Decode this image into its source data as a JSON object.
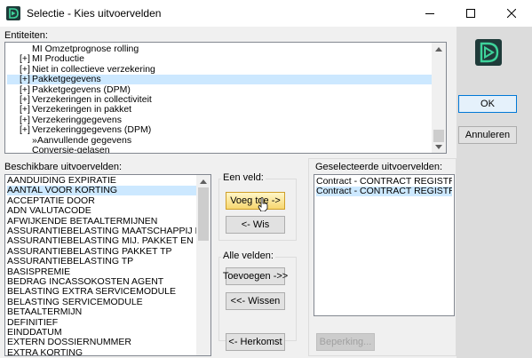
{
  "window": {
    "title": "Selectie - Kies uitvoervelden"
  },
  "entities": {
    "label": "Entiteiten:",
    "items": [
      {
        "prefix": "",
        "text": "MI Omzetprognose rolling",
        "selected": false
      },
      {
        "prefix": "[+]",
        "text": "MI Productie",
        "selected": false
      },
      {
        "prefix": "[+]",
        "text": "Niet in collectieve verzekering",
        "selected": false
      },
      {
        "prefix": "[+]",
        "text": "Pakketgegevens",
        "selected": true
      },
      {
        "prefix": "[+]",
        "text": "Pakketgegevens (DPM)",
        "selected": false
      },
      {
        "prefix": "[+]",
        "text": "Verzekeringen in collectiviteit",
        "selected": false
      },
      {
        "prefix": "[+]",
        "text": "Verzekeringen in pakket",
        "selected": false
      },
      {
        "prefix": "[+]",
        "text": "Verzekeringgegevens",
        "selected": false
      },
      {
        "prefix": "[+]",
        "text": "Verzekeringgegevens (DPM)",
        "selected": false
      },
      {
        "prefix": "",
        "text": "»Aanvullende gegevens",
        "selected": false
      },
      {
        "prefix": "",
        "text": "Conversie-gelasen",
        "selected": false
      }
    ]
  },
  "buttons": {
    "ok": "OK",
    "cancel": "Annuleren",
    "add_one": "Voeg toe ->",
    "remove_one": "<- Wis",
    "add_all": "Toevoegen ->>",
    "remove_all": "<<- Wissen",
    "origin": "<- Herkomst",
    "limit": "Beperking..."
  },
  "available": {
    "label": "Beschikbare uitvoervelden:",
    "items": [
      {
        "text": "AANDUIDING EXPIRATIE",
        "selected": false
      },
      {
        "text": "AANTAL VOOR KORTING",
        "selected": true
      },
      {
        "text": "ACCEPTATIE DOOR",
        "selected": false
      },
      {
        "text": "ADN VALUTACODE",
        "selected": false
      },
      {
        "text": "AFWIJKENDE BETAALTERMIJNEN",
        "selected": false
      },
      {
        "text": "ASSURANTIEBELASTING MAATSCHAPPIJ PAKKET",
        "selected": false
      },
      {
        "text": "ASSURANTIEBELASTING MIJ. PAKKET EN POLIS",
        "selected": false
      },
      {
        "text": "ASSURANTIEBELASTING PAKKET TP",
        "selected": false
      },
      {
        "text": "ASSURANTIEBELASTING TP",
        "selected": false
      },
      {
        "text": "BASISPREMIE",
        "selected": false
      },
      {
        "text": "BEDRAG INCASSOKOSTEN AGENT",
        "selected": false
      },
      {
        "text": "BELASTING EXTRA SERVICEMODULE",
        "selected": false
      },
      {
        "text": "BELASTING SERVICEMODULE",
        "selected": false
      },
      {
        "text": "BETAALTERMIJN",
        "selected": false
      },
      {
        "text": "DEFINITIEF",
        "selected": false
      },
      {
        "text": "EINDDATUM",
        "selected": false
      },
      {
        "text": "EXTERN DOSSIERNUMMER",
        "selected": false
      },
      {
        "text": "EXTRA KORTING",
        "selected": false
      }
    ]
  },
  "one_field": {
    "label": "Een veld:"
  },
  "all_fields": {
    "label": "Alle velden:"
  },
  "selected": {
    "label": "Geselecteerde uitvoervelden:",
    "items": [
      {
        "text": "Contract - CONTRACT REGISTRATIENUMMER",
        "selected": false
      },
      {
        "text": "Contract - CONTRACT REGISTRATIENUMMER",
        "selected": true
      }
    ]
  },
  "colors": {
    "selection": "#cce8ff",
    "focus_border": "#0078d7",
    "hot_button": "#f7d770",
    "logo_bg": "#1f3b3a",
    "logo_fg": "#3ed39b"
  },
  "icons": {
    "app": "teal-d-logo-icon",
    "minimize": "minimize-icon",
    "maximize": "maximize-icon",
    "close": "close-icon"
  }
}
